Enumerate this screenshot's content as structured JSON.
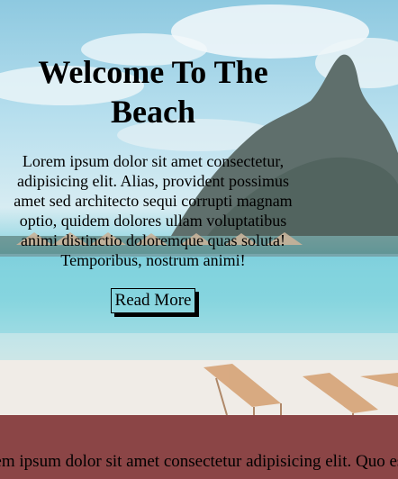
{
  "hero": {
    "title": "Welcome To The Beach",
    "text": "Lorem ipsum dolor sit amet consectetur, adipisicing elit. Alias, provident possimus amet sed architecto sequi corrupti magnam optio, quidem dolores ullam voluptatibus animi distinctio doloremque quas soluta! Temporibus, nostrum animi!",
    "button_label": "Read More"
  },
  "band": {
    "text": "Lorem ipsum dolor sit amet consectetur adipisicing elit. Quo esse"
  },
  "colors": {
    "band": "#8b4546",
    "sky": "#8ec9e0",
    "water": "#7fd0dd",
    "sand": "#f3efea"
  }
}
